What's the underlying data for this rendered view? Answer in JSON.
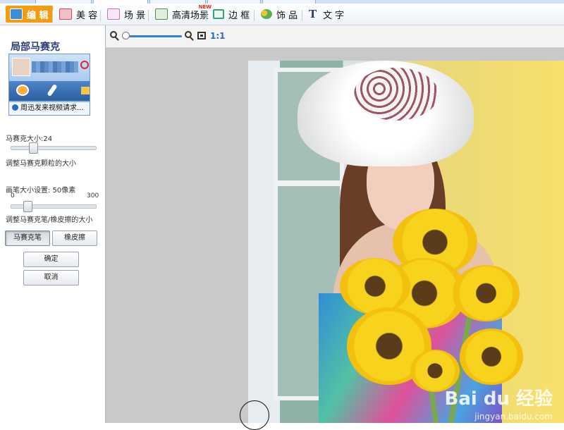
{
  "toolbar": {
    "items": [
      {
        "label": "编 辑",
        "icon": "edit-icon",
        "color": "#3a8fd8"
      },
      {
        "label": "美 容",
        "icon": "beauty-icon",
        "color": "#d04a6a"
      },
      {
        "label": "场 景",
        "icon": "scene-icon",
        "color": "#b879b8"
      },
      {
        "label": "高清场景",
        "icon": "hd-scene-icon",
        "color": "#5a8a4a"
      },
      {
        "label": "边 框",
        "icon": "frame-icon",
        "color": "#3aa07a"
      },
      {
        "label": "饰 品",
        "icon": "accessory-icon",
        "color": "#5bb050"
      },
      {
        "label": "文 字",
        "icon": "text-icon",
        "color": "#2b3f77"
      }
    ],
    "new_badge": "NEW",
    "text_glyph": "T"
  },
  "panel": {
    "title": "局部马赛克",
    "preview_caption": "周迅发来视频请求...",
    "mosaic_size_label": "马赛克大小:24",
    "mosaic_size_level": 0.24,
    "mosaic_hint": "调整马赛克颗粒的大小",
    "brush_size_label": "画笔大小设置: 50像素",
    "brush_min": "0",
    "brush_max": "300",
    "brush_value": 50,
    "brush_hint": "调整马赛克笔/橡皮擦的大小",
    "mosaic_pen_label": "马赛克笔",
    "eraser_label": "橡皮擦",
    "ok_label": "确定",
    "cancel_label": "取消"
  },
  "zoom": {
    "ratio_label": "1:1",
    "level": 0
  },
  "watermark": {
    "brand": "Bai du 经验",
    "url": "jingyan.baidu.com"
  }
}
